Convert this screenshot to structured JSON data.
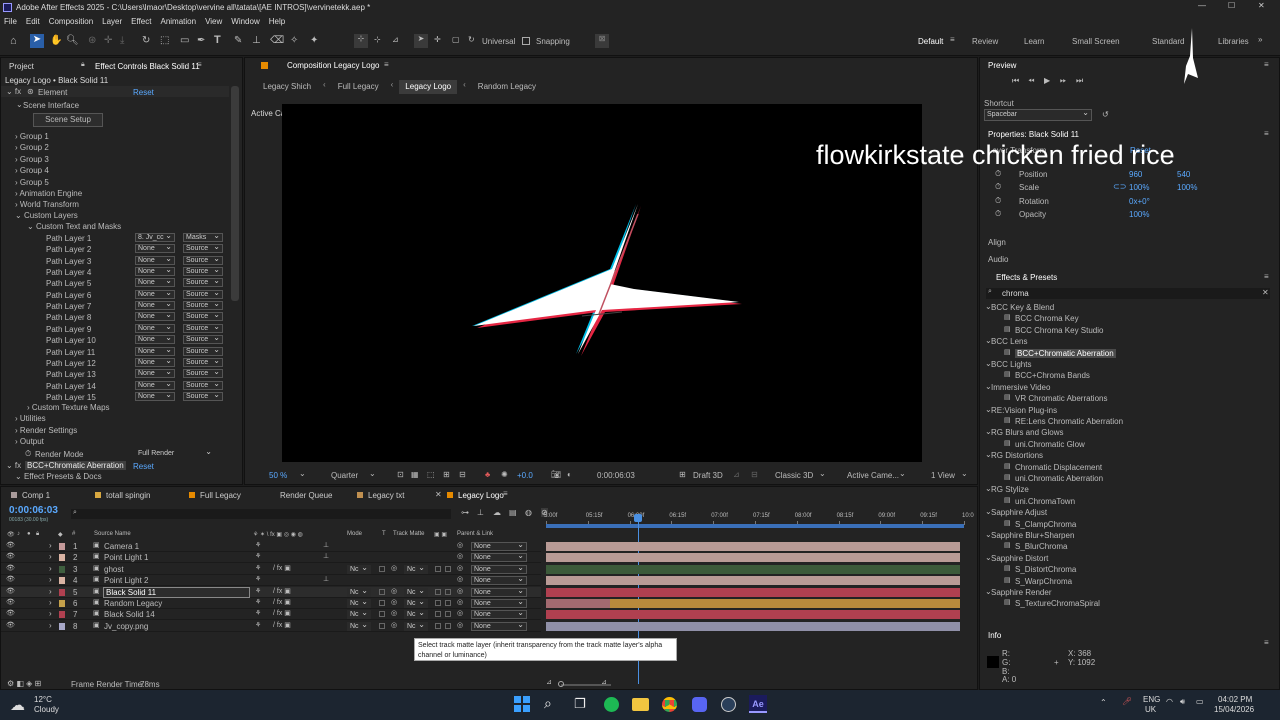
{
  "titlebar": {
    "title": "Adobe After Effects 2025 - C:\\Users\\lmaor\\Desktop\\vervine all\\tatata\\[AE INTROS]\\vervinetekk.aep *"
  },
  "menu": [
    "File",
    "Edit",
    "Composition",
    "Layer",
    "Effect",
    "Animation",
    "View",
    "Window",
    "Help"
  ],
  "toolbar": {
    "universal": "Universal",
    "snapping": "Snapping"
  },
  "workspaces": [
    "Default",
    "Review",
    "Learn",
    "Small Screen",
    "Standard",
    "Libraries"
  ],
  "left_panel": {
    "tab_project": "Project",
    "tab_effect": "Effect Controls Black Solid 11",
    "breadcrumb": "Legacy Logo • Black Solid 11",
    "element": "Element",
    "reset": "Reset",
    "scene_interface": "Scene Interface",
    "scene_setup": "Scene Setup",
    "groups": [
      "Group 1",
      "Group 2",
      "Group 3",
      "Group 4",
      "Group 5",
      "Animation Engine",
      "World Transform"
    ],
    "custom_layers": "Custom Layers",
    "custom_text": "Custom Text and Masks",
    "path_layers": [
      {
        "name": "Path Layer 1",
        "a": "8. Jv_cc",
        "b": "Masks"
      },
      {
        "name": "Path Layer 2",
        "a": "None",
        "b": "Source"
      },
      {
        "name": "Path Layer 3",
        "a": "None",
        "b": "Source"
      },
      {
        "name": "Path Layer 4",
        "a": "None",
        "b": "Source"
      },
      {
        "name": "Path Layer 5",
        "a": "None",
        "b": "Source"
      },
      {
        "name": "Path Layer 6",
        "a": "None",
        "b": "Source"
      },
      {
        "name": "Path Layer 7",
        "a": "None",
        "b": "Source"
      },
      {
        "name": "Path Layer 8",
        "a": "None",
        "b": "Source"
      },
      {
        "name": "Path Layer 9",
        "a": "None",
        "b": "Source"
      },
      {
        "name": "Path Layer 10",
        "a": "None",
        "b": "Source"
      },
      {
        "name": "Path Layer 11",
        "a": "None",
        "b": "Source"
      },
      {
        "name": "Path Layer 12",
        "a": "None",
        "b": "Source"
      },
      {
        "name": "Path Layer 13",
        "a": "None",
        "b": "Source"
      },
      {
        "name": "Path Layer 14",
        "a": "None",
        "b": "Source"
      },
      {
        "name": "Path Layer 15",
        "a": "None",
        "b": "Source"
      }
    ],
    "tail": [
      "Custom Texture Maps",
      "Utilities",
      "Render Settings",
      "Output"
    ],
    "render_mode": "Render Mode",
    "render_mode_val": "Full Render",
    "bcc": "BCC+Chromatic Aberration",
    "bcc_reset": "Reset",
    "effect_presets": "Effect Presets & Docs"
  },
  "comp": {
    "tab": "Composition Legacy Logo",
    "crumbs": [
      "Legacy Shich",
      "Full Legacy",
      "Legacy Logo",
      "Random Legacy"
    ],
    "camera": "Active Camera (Camera 1)",
    "zoom": "50 %",
    "quality": "Quarter",
    "exposure": "+0.0",
    "time": "0:00:06:03",
    "draft": "Draft 3D",
    "renderer": "Classic 3D",
    "view": "Active Came...",
    "views": "1 View"
  },
  "right_panel": {
    "preview": "Preview",
    "shortcut": "Shortcut",
    "shortcut_val": "Spacebar",
    "properties": "Properties: Black Solid 11",
    "layer_transform": "Layer Transform",
    "reset": "Reset",
    "transform": [
      {
        "label": "Position",
        "v1": "960",
        "v2": "540"
      },
      {
        "label": "Scale",
        "v1": "100%",
        "v2": "100%"
      },
      {
        "label": "Rotation",
        "v1": "0x+0°",
        "v2": ""
      },
      {
        "label": "Opacity",
        "v1": "100%",
        "v2": ""
      }
    ],
    "align": "Align",
    "audio": "Audio",
    "effects_presets": "Effects & Presets",
    "search": "chroma",
    "fx_tree": [
      {
        "t": "BCC Key & Blend",
        "cat": true
      },
      {
        "t": "BCC Chroma Key"
      },
      {
        "t": "BCC Chroma Key Studio"
      },
      {
        "t": "BCC Lens",
        "cat": true
      },
      {
        "t": "BCC+Chromatic Aberration",
        "sel": true
      },
      {
        "t": "BCC Lights",
        "cat": true
      },
      {
        "t": "BCC+Chroma Bands"
      },
      {
        "t": "Immersive Video",
        "cat": true
      },
      {
        "t": "VR Chromatic Aberrations"
      },
      {
        "t": "RE:Vision Plug-ins",
        "cat": true
      },
      {
        "t": "RE:Lens Chromatic Aberration"
      },
      {
        "t": "RG Blurs and Glows",
        "cat": true
      },
      {
        "t": "uni.Chromatic Glow"
      },
      {
        "t": "RG Distortions",
        "cat": true
      },
      {
        "t": "Chromatic Displacement"
      },
      {
        "t": "uni.Chromatic Aberration"
      },
      {
        "t": "RG Stylize",
        "cat": true
      },
      {
        "t": "uni.ChromaTown"
      },
      {
        "t": "Sapphire Adjust",
        "cat": true
      },
      {
        "t": "S_ClampChroma"
      },
      {
        "t": "Sapphire Blur+Sharpen",
        "cat": true
      },
      {
        "t": "S_BlurChroma"
      },
      {
        "t": "Sapphire Distort",
        "cat": true
      },
      {
        "t": "S_DistortChroma"
      },
      {
        "t": "S_WarpChroma"
      },
      {
        "t": "Sapphire Render",
        "cat": true
      },
      {
        "t": "S_TextureChromaSpiral"
      }
    ],
    "info": "Info",
    "info_r": "R:",
    "info_g": "G:",
    "info_b": "B:",
    "info_a": "A: 0",
    "info_x": "X: 368",
    "info_y": "Y: 1092"
  },
  "overlay": "flowkirkstate chicken fried rice",
  "timeline": {
    "tabs": [
      "Comp 1",
      "totall spingin",
      "Full Legacy",
      "Render Queue",
      "Legacy txt",
      "Legacy Logo"
    ],
    "timecode": "0:00:06:03",
    "timecode_sub": "00183 (30.00 fps)",
    "headers": {
      "num": "#",
      "source": "Source Name",
      "mode": "Mode",
      "t": "T",
      "matte": "Track Matte",
      "parent": "Parent & Link"
    },
    "ruler": [
      "5:00f",
      "05:15f",
      "06:00f",
      "06:15f",
      "07:00f",
      "07:15f",
      "08:00f",
      "08:15f",
      "09:00f",
      "09:15f",
      "10:0"
    ],
    "layers": [
      {
        "n": "1",
        "name": "Camera 1",
        "mode": "",
        "matte": "",
        "parent": "None",
        "color": "#c59a9a",
        "bar": "#b99b96"
      },
      {
        "n": "2",
        "name": "Point Light 1",
        "mode": "",
        "matte": "",
        "parent": "None",
        "color": "#d9b3a3",
        "bar": "#b99b96"
      },
      {
        "n": "3",
        "name": "ghost",
        "mode": "Nc",
        "matte": "Nc",
        "parent": "None",
        "color": "#3f5f3f",
        "bar": "#3c5a3a"
      },
      {
        "n": "4",
        "name": "Point Light 2",
        "mode": "",
        "matte": "",
        "parent": "None",
        "color": "#d9b3a3",
        "bar": "#b99b96"
      },
      {
        "n": "5",
        "name": "Black Solid 11",
        "mode": "Nc",
        "matte": "Nc",
        "parent": "None",
        "color": "#b04050",
        "bar": "#b04050"
      },
      {
        "n": "6",
        "name": "Random Legacy",
        "mode": "Nc",
        "matte": "Nc",
        "parent": "None",
        "color": "#c4a04a",
        "bar": "#a0844a"
      },
      {
        "n": "7",
        "name": "Black Solid 14",
        "mode": "Nc",
        "matte": "Nc",
        "parent": "None",
        "color": "#b04050",
        "bar": "#b04050"
      },
      {
        "n": "8",
        "name": "Jv_copy.png",
        "mode": "Nc",
        "matte": "Nc",
        "parent": "None",
        "color": "#a8a8c8",
        "bar": "#9090a8"
      }
    ],
    "tooltip": "Select track matte layer (inherit transparency from the track matte layer's alpha channel or luminance)",
    "frame_render": "Frame Render Time:",
    "frame_render_val": "78ms"
  },
  "taskbar": {
    "temp": "12°C",
    "weather": "Cloudy",
    "lang": "ENG",
    "region": "UK",
    "time": "04:02 PM",
    "date": "15/04/2026"
  }
}
